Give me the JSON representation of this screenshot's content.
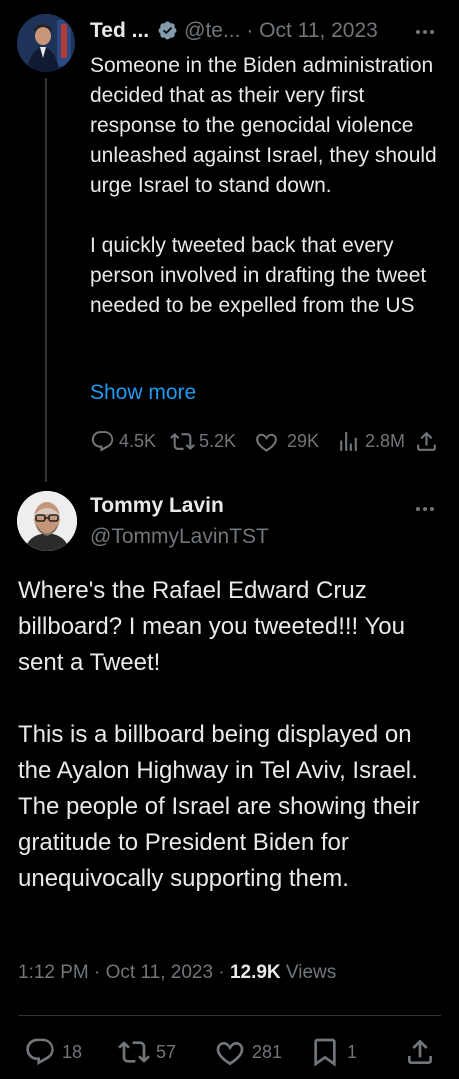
{
  "parent_tweet": {
    "author_name": "Ted ...",
    "handle": "@te...",
    "separator": "·",
    "date": "Oct 11, 2023",
    "paragraphs": [
      "Someone in the Biden administration decided that as their very first response to the genocidal violence unleashed against Israel, they should urge Israel to stand down.",
      "I quickly tweeted back that every person involved in drafting the tweet needed to be expelled from the US"
    ],
    "show_more": "Show more",
    "replies": "4.5K",
    "reposts": "5.2K",
    "likes": "29K",
    "views": "2.8M"
  },
  "main_tweet": {
    "author_name": "Tommy Lavin",
    "handle": "@TommyLavinTST",
    "paragraphs": [
      "Where's the Rafael Edward Cruz billboard? I mean you tweeted!!! You sent a Tweet!",
      "This is a billboard being displayed on the Ayalon Highway in Tel Aviv, Israel. The people of Israel are showing their gratitude to President Biden for unequivocally supporting them."
    ],
    "time": "1:12 PM",
    "meta_separator": "·",
    "date": "Oct 11, 2023",
    "views_count": "12.9K",
    "views_label": "Views",
    "replies": "18",
    "reposts": "57",
    "likes": "281",
    "bookmarks": "1"
  },
  "colors": {
    "background": "#000000",
    "text": "#e7e9ea",
    "muted": "#71767b",
    "link": "#1d9bf0",
    "verified": "#829aab"
  },
  "icons": [
    "more-icon",
    "verified-badge-icon",
    "reply-icon",
    "repost-icon",
    "like-icon",
    "views-icon",
    "share-icon",
    "bookmark-icon"
  ]
}
